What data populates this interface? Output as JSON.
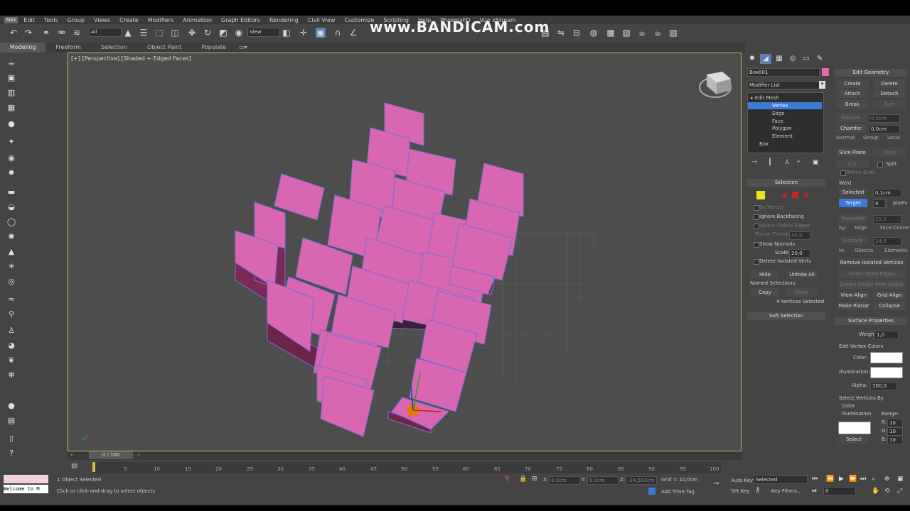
{
  "window": {
    "logo": "MAX"
  },
  "menu": [
    "Edit",
    "Tools",
    "Group",
    "Views",
    "Create",
    "Modifiers",
    "Animation",
    "Graph Editors",
    "Rendering",
    "Civil View",
    "Customize",
    "Scripting",
    "Help",
    "PhoenixFD",
    "Vue xStream"
  ],
  "watermark": "www.BANDICAM.com",
  "toolbar": {
    "selection_filter": "All",
    "ref_coord": "View"
  },
  "ribbon_tabs": [
    {
      "label": "Modeling",
      "active": true
    },
    {
      "label": "Freeform",
      "active": false
    },
    {
      "label": "Selection",
      "active": false
    },
    {
      "label": "Object Paint",
      "active": false
    },
    {
      "label": "Populate",
      "active": false
    }
  ],
  "viewport": {
    "label": "[+] [Perspective] [Shaded + Edged Faces]"
  },
  "command_panel": {
    "object_name": "Box001",
    "object_color": "#e06cb0",
    "modifier_list": "Modifier List",
    "stack": [
      {
        "label": "Edit Mesh",
        "level": 0,
        "selected": false
      },
      {
        "label": "Vertex",
        "level": 1,
        "selected": true
      },
      {
        "label": "Edge",
        "level": 1,
        "selected": false
      },
      {
        "label": "Face",
        "level": 1,
        "selected": false
      },
      {
        "label": "Polygon",
        "level": 1,
        "selected": false
      },
      {
        "label": "Element",
        "level": 1,
        "selected": false
      },
      {
        "label": "Box",
        "level": 0,
        "selected": false
      }
    ],
    "selection": {
      "title": "Selection",
      "by_vertex": "By Vertex",
      "ignore_backfacing": "Ignore Backfacing",
      "ignore_visible_edges": "Ignore Visible Edges",
      "planar_thresh_label": "Planar Thresh:",
      "planar_thresh_value": "45,0",
      "show_normals": "Show Normals",
      "scale_label": "Scale:",
      "scale_value": "20,0",
      "delete_isolated": "Delete Isolated Verts",
      "hide": "Hide",
      "unhide_all": "Unhide All",
      "named_selections": "Named Selections:",
      "copy": "Copy",
      "paste": "Paste",
      "status": "4 Vertices Selected"
    },
    "soft_selection": "Soft Selection",
    "edit_geometry": {
      "title": "Edit Geometry",
      "create": "Create",
      "delete": "Delete",
      "attach": "Attach",
      "detach": "Detach",
      "break": "Break",
      "turn": "Turn",
      "extrude": "Extrude",
      "extrude_value": "0,0cm",
      "chamfer": "Chamfer",
      "chamfer_value": "0,0cm",
      "normal_label": "Normal:",
      "group": "Group",
      "local": "Local",
      "slice_plane": "Slice Plane",
      "slice": "Slice",
      "cut": "Cut",
      "split": "Split",
      "refine_ends": "Refine Ends",
      "weld": "Weld",
      "selected": "Selected",
      "selected_value": "0,1cm",
      "target": "Target",
      "target_value": "4",
      "pixels": "pixels",
      "tessellate": "Tessellate",
      "tessellate_value": "25,0",
      "by_label": "by:",
      "edge": "Edge",
      "face_center": "Face-Center",
      "explode": "Explode",
      "explode_value": "24,0",
      "to_label": "to:",
      "objects": "Objects",
      "elements": "Elements",
      "remove_isolated": "Remove Isolated Vertices",
      "select_open_edges": "Select Open Edges",
      "create_shape": "Create Shape from Edges",
      "view_align": "View Align",
      "grid_align": "Grid Align",
      "make_planar": "Make Planar",
      "collapse": "Collapse"
    },
    "surface": {
      "title": "Surface Properties",
      "weight_label": "Weight:",
      "weight_value": "1,0",
      "edit_vertex_colors": "Edit Vertex Colors",
      "color_label": "Color:",
      "illumination_label": "Illumination:",
      "alpha_label": "Alpha:",
      "alpha_value": "100,0",
      "select_vertices_by": "Select Vertices By",
      "color_opt": "Color",
      "illum_opt": "Illumination",
      "range": "Range:",
      "r": "R:",
      "g": "G:",
      "b": "B:",
      "r_val": "10",
      "g_val": "10",
      "b_val": "10",
      "select": "Select"
    }
  },
  "timeline": {
    "frame": "0 / 100",
    "ticks": [
      "0",
      "5",
      "10",
      "15",
      "20",
      "25",
      "30",
      "35",
      "40",
      "45",
      "50",
      "55",
      "60",
      "65",
      "70",
      "75",
      "80",
      "85",
      "90",
      "95",
      "100"
    ]
  },
  "status": {
    "maxscript": "Welcome to M",
    "objects_selected": "1 Object Selected",
    "prompt": "Click or click-and-drag to select objects",
    "x_label": "X:",
    "x_value": "0,0cm",
    "y_label": "Y:",
    "y_value": "0,0cm",
    "z_label": "Z:",
    "z_value": "-24,503cm",
    "grid": "Grid = 10,0cm",
    "add_time_tag": "Add Time Tag",
    "auto_key": "Auto Key",
    "set_key": "Set Key",
    "selected_dropdown": "Selected",
    "key_filters": "Key Filters...",
    "frame_value": "0"
  }
}
